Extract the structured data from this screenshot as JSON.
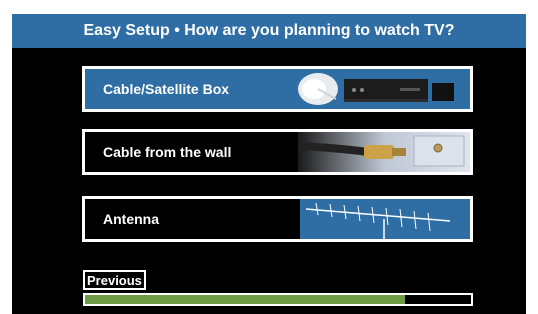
{
  "title": "Easy Setup • How are you planning to watch TV?",
  "options": [
    {
      "label": "Cable/Satellite Box",
      "art_icon": "satellite-dish-and-box-icon"
    },
    {
      "label": "Cable from the wall",
      "art_icon": "coax-cable-wall-plate-icon"
    },
    {
      "label": "Antenna",
      "art_icon": "tv-antenna-icon"
    }
  ],
  "previous_label": "Previous",
  "progress_fraction": 0.83,
  "colors": {
    "title_bg": "#2f6ea5",
    "selected_bg": "#2f6ea5",
    "progress": "#6f9a45",
    "screen_bg": "#000000"
  }
}
